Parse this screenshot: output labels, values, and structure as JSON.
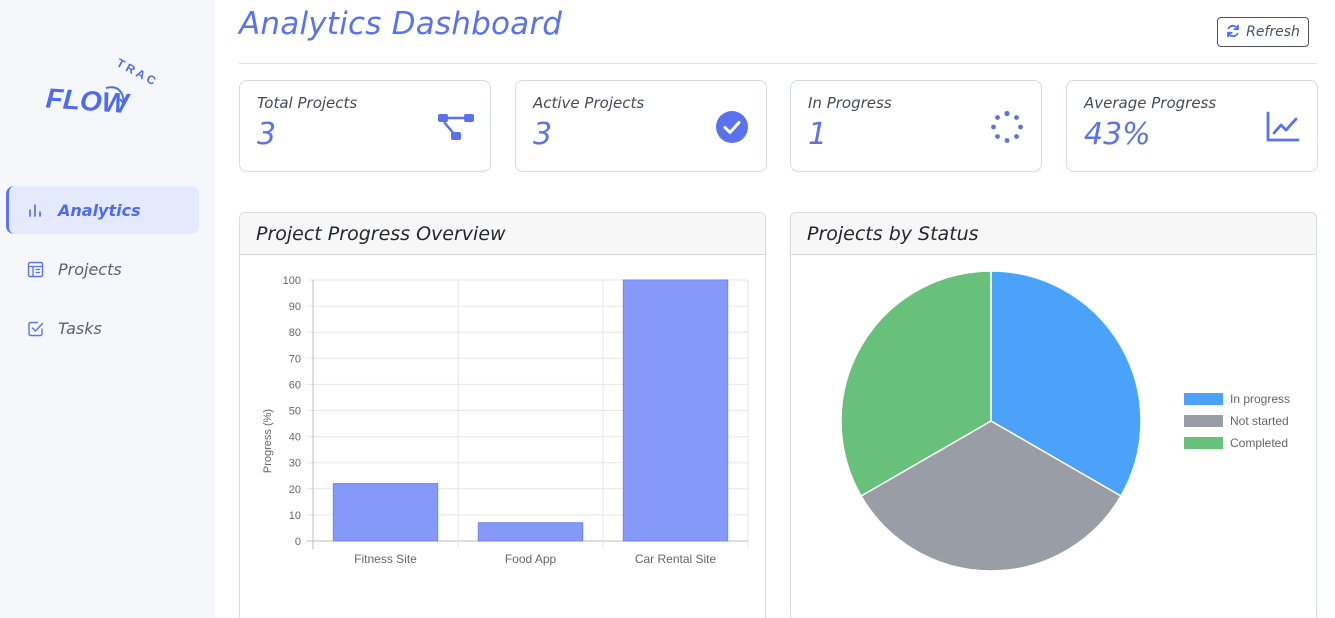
{
  "logo": {
    "word1": "FLOW",
    "word2": "TRACK"
  },
  "sidebar": {
    "items": [
      {
        "label": "Analytics",
        "icon": "bar-chart-icon",
        "active": true
      },
      {
        "label": "Projects",
        "icon": "table-icon",
        "active": false
      },
      {
        "label": "Tasks",
        "icon": "checkbox-icon",
        "active": false
      }
    ]
  },
  "header": {
    "title": "Analytics Dashboard",
    "refresh_label": "Refresh"
  },
  "stats": [
    {
      "label": "Total Projects",
      "value": "3",
      "icon": "hierarchy-icon"
    },
    {
      "label": "Active Projects",
      "value": "3",
      "icon": "check-circle-icon"
    },
    {
      "label": "In Progress",
      "value": "1",
      "icon": "spinner-icon"
    },
    {
      "label": "Average Progress",
      "value": "43%",
      "icon": "line-chart-icon"
    }
  ],
  "panels": {
    "progress_title": "Project Progress Overview",
    "status_title": "Projects by Status"
  },
  "colors": {
    "accent": "#5a73ec",
    "bar": "#8599fb",
    "in_progress": "#4aa3f9",
    "not_started": "#999ea6",
    "completed": "#67c17a"
  },
  "chart_data": [
    {
      "type": "bar",
      "categories": [
        "Fitness Site",
        "Food App",
        "Car Rental Site"
      ],
      "values": [
        22,
        7,
        100
      ],
      "ylabel": "Progress (%)",
      "ylim": [
        0,
        100
      ],
      "yticks": [
        "0",
        "10",
        "20",
        "30",
        "40",
        "50",
        "60",
        "70",
        "80",
        "90",
        "100"
      ],
      "grid": true
    },
    {
      "type": "pie",
      "labels": [
        "In progress",
        "Not started",
        "Completed"
      ],
      "values": [
        1,
        1,
        1
      ],
      "colors": [
        "#4aa3f9",
        "#999ea6",
        "#67c17a"
      ],
      "legend": "right"
    }
  ]
}
